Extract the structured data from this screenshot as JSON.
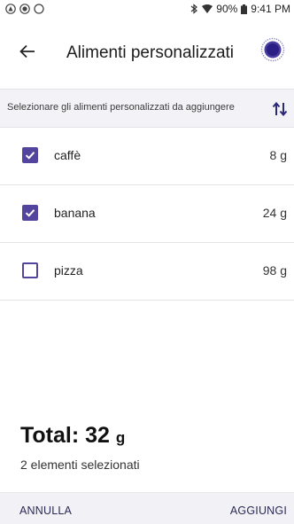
{
  "status_bar": {
    "battery_percent": "90%",
    "time": "9:41 PM"
  },
  "header": {
    "title": "Alimenti personalizzati"
  },
  "subheader": {
    "instruction": "Selezionare gli alimenti personalizzati da aggiungere"
  },
  "items": [
    {
      "name": "caffè",
      "amount": "8 g",
      "checked": true
    },
    {
      "name": "banana",
      "amount": "24 g",
      "checked": true
    },
    {
      "name": "pizza",
      "amount": "98 g",
      "checked": false
    }
  ],
  "summary": {
    "total_label": "Total: 32",
    "total_unit": "g",
    "selected_text": "2 elementi selezionati"
  },
  "actions": {
    "cancel_label": "ANNULLA",
    "add_label": "AGGIUNGI"
  },
  "colors": {
    "accent": "#53449d",
    "panel_bg": "#f3f2f7"
  }
}
